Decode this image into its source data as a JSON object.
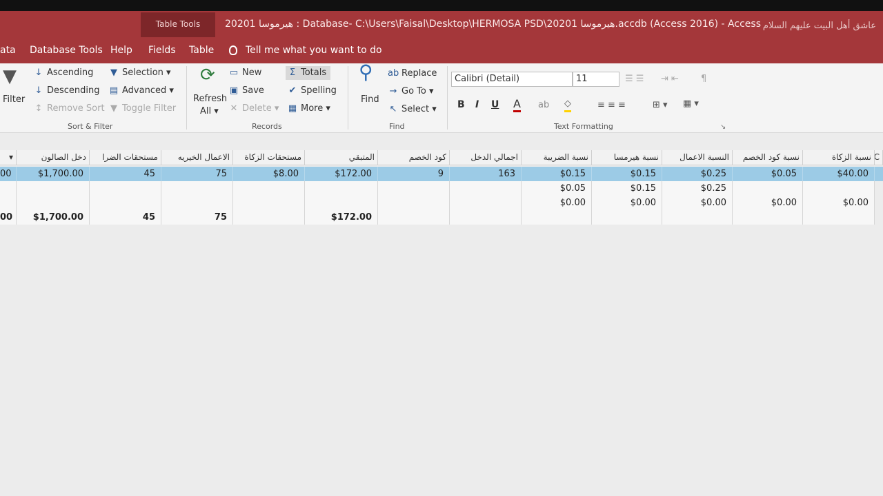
{
  "window": {
    "context_tab": "Table Tools",
    "title": "20201 هيرموسا : Database- C:\\Users\\Faisal\\Desktop\\HERMOSA PSD\\20201 هيرموسا.accdb (Access 2016)  -  Access",
    "rtl_text": "عاشق أهل البيت عليهم السلام"
  },
  "tabs": [
    "ata",
    "Database Tools",
    "Help",
    "Fields",
    "Table"
  ],
  "tell_me": "Tell me what you want to do",
  "ribbon": {
    "sort_filter": {
      "filter": "Filter",
      "ascending": "Ascending",
      "descending": "Descending",
      "remove_sort": "Remove Sort",
      "selection": "Selection",
      "advanced": "Advanced",
      "toggle_filter": "Toggle Filter",
      "group_label": "Sort & Filter"
    },
    "records": {
      "refresh": "Refresh",
      "refresh_all": "All",
      "new": "New",
      "save": "Save",
      "delete": "Delete",
      "totals": "Totals",
      "spelling": "Spelling",
      "more": "More",
      "group_label": "Records"
    },
    "find": {
      "find": "Find",
      "replace": "Replace",
      "go_to": "Go To",
      "select": "Select",
      "group_label": "Find"
    },
    "text_formatting": {
      "font": "Calibri (Detail)",
      "size": "11",
      "bold": "B",
      "italic": "I",
      "underline": "U",
      "group_label": "Text Formatting"
    }
  },
  "table": {
    "headers": [
      "دخل الصالون",
      "مستحقات الضرا",
      "الاعمال الخيريه",
      "مستحقات الزكاة",
      "المتبقي",
      "كود الخصم",
      "اجمالي الدخل",
      "نسبة الضريبة",
      "نسبة هيرمسا",
      "النسبة الاعمال",
      "نسبة كود الخصم",
      "نسبة الزكاة"
    ],
    "rows": [
      [
        "$1,700.00",
        "45",
        "75",
        "$8.00",
        "$172.00",
        "9",
        "163",
        "$0.15",
        "$0.15",
        "$0.25",
        "$0.05",
        "$40.00"
      ],
      [
        "",
        "",
        "",
        "",
        "",
        "",
        "",
        "$0.05",
        "$0.15",
        "$0.25",
        "",
        ""
      ],
      [
        "",
        "",
        "",
        "",
        "",
        "",
        "",
        "$0.00",
        "$0.00",
        "$0.00",
        "$0.00",
        "$0.00"
      ]
    ],
    "totals": [
      "$1,700.00",
      "45",
      "75",
      "",
      "$172.00",
      "",
      "",
      "",
      "",
      "",
      "",
      ""
    ],
    "left_stub": [
      "00",
      "",
      "",
      "00"
    ]
  }
}
